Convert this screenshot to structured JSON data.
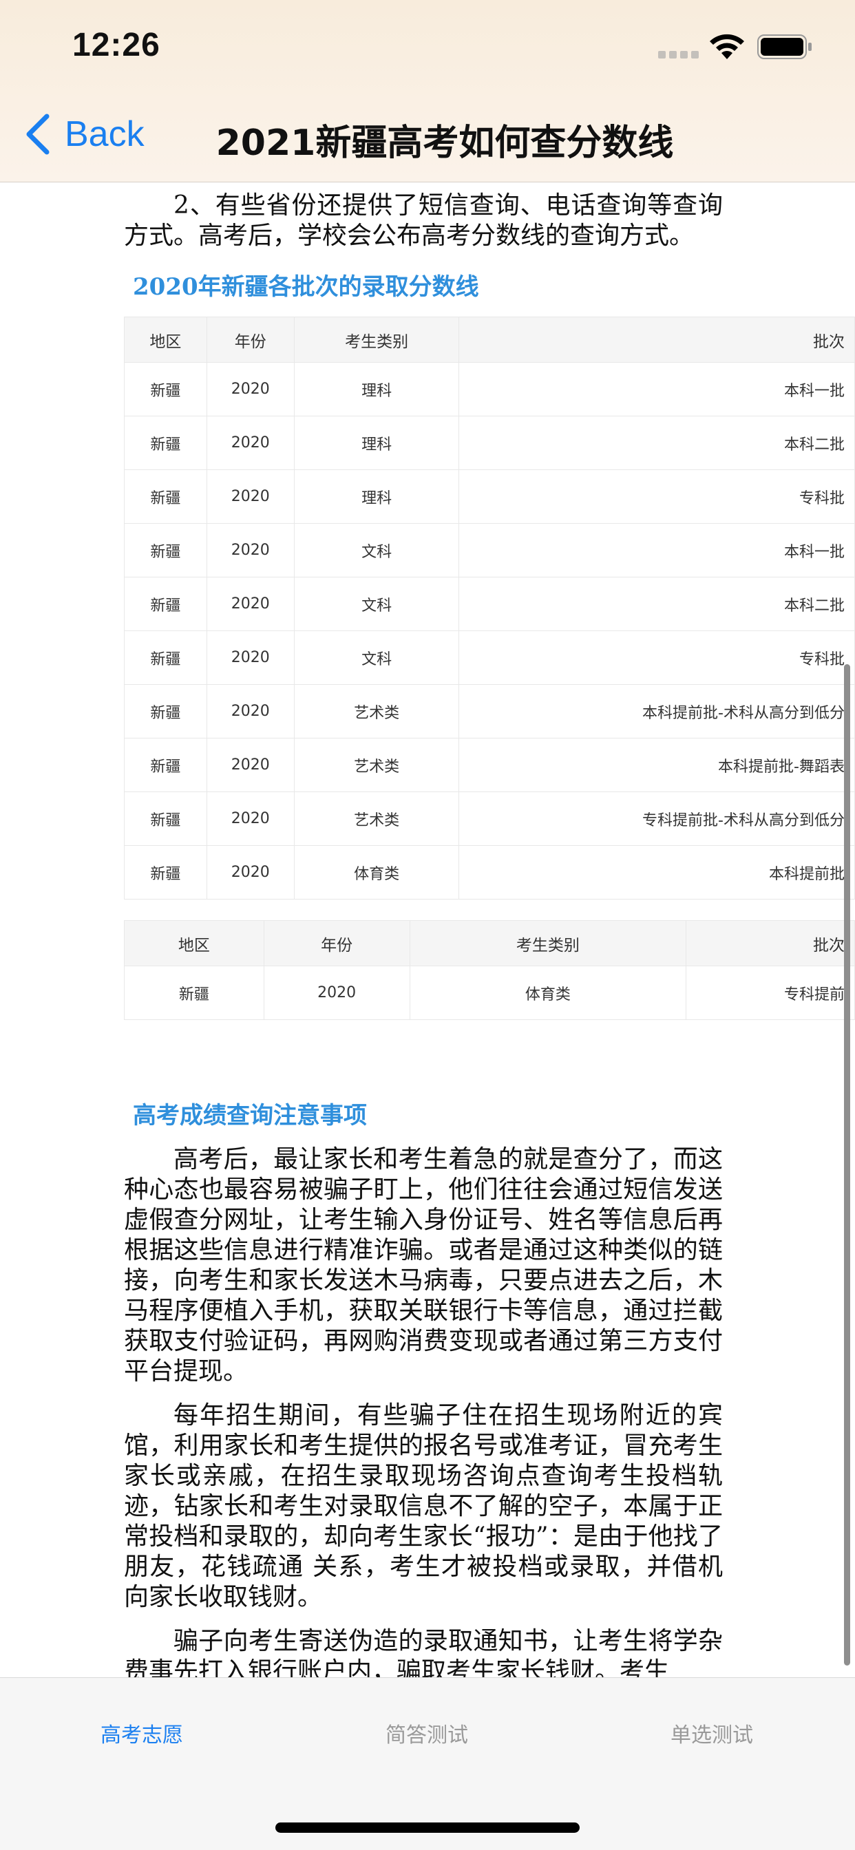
{
  "status_bar": {
    "time": "12:26"
  },
  "nav": {
    "back_label": "Back",
    "title": "2021新疆高考如何查分数线"
  },
  "intro_paragraph": "2、有些省份还提供了短信查询、电话查询等查询方式。高考后，学校会公布高考分数线的查询方式。",
  "section1_heading": "2020年新疆各批次的录取分数线",
  "table1": {
    "headers": [
      "地区",
      "年份",
      "考生类别",
      "批次"
    ],
    "rows": [
      [
        "新疆",
        "2020",
        "理科",
        "本科一批"
      ],
      [
        "新疆",
        "2020",
        "理科",
        "本科二批"
      ],
      [
        "新疆",
        "2020",
        "理科",
        "专科批"
      ],
      [
        "新疆",
        "2020",
        "文科",
        "本科一批"
      ],
      [
        "新疆",
        "2020",
        "文科",
        "本科二批"
      ],
      [
        "新疆",
        "2020",
        "文科",
        "专科批"
      ],
      [
        "新疆",
        "2020",
        "艺术类",
        "本科提前批-术科从高分到低分"
      ],
      [
        "新疆",
        "2020",
        "艺术类",
        "本科提前批-舞蹈表"
      ],
      [
        "新疆",
        "2020",
        "艺术类",
        "专科提前批-术科从高分到低分"
      ],
      [
        "新疆",
        "2020",
        "体育类",
        "本科提前批"
      ]
    ]
  },
  "table2": {
    "headers": [
      "地区",
      "年份",
      "考生类别",
      "批次"
    ],
    "rows": [
      [
        "新疆",
        "2020",
        "体育类",
        "专科提前"
      ]
    ]
  },
  "section2_heading": "高考成绩查询注意事项",
  "paragraphs": [
    "高考后，最让家长和考生着急的就是查分了，而这种心态也最容易被骗子盯上，他们往往会通过短信发送虚假查分网址，让考生输入身份证号、姓名等信息后再根据这些信息进行精准诈骗。或者是通过这种类似的链接，向考生和家长发送木马病毒，只要点进去之后，木马程序便植入手机，获取关联银行卡等信息，通过拦截获取支付验证码，再网购消费变现或者通过第三方支付平台提现。",
    "每年招生期间，有些骗子住在招生现场附近的宾馆，利用家长和考生提供的报名号或准考证，冒充考生家长或亲戚，在招生录取现场咨询点查询考生投档轨迹，钻家长和考生对录取信息不了解的空子，本属于正常投档和录取的，却向考生家长“报功”：是由于他找了朋友，花钱疏通 关系，考生才被投档或录取，并借机向家长收取钱财。",
    "骗子向考生寄送伪造的录取通知书，让考生将学杂费事先打入银行账户内，骗取考生家长钱财。考生"
  ],
  "tabs": [
    {
      "label": "高考志愿",
      "active": true
    },
    {
      "label": "简答测试",
      "active": false
    },
    {
      "label": "单选测试",
      "active": false
    }
  ],
  "colors": {
    "accent": "#1a7ff0",
    "heading": "#2f8fdc",
    "header_bg": "#f8ecdc"
  }
}
